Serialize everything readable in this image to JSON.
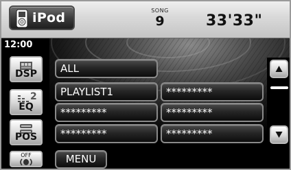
{
  "header": {
    "source_label": "iPod",
    "song_caption": "SONG",
    "song_number": "9",
    "play_time": "33'33\""
  },
  "clock": "12:00",
  "side_buttons": {
    "dsp": {
      "label": "DSP",
      "icon": "dsp-icon"
    },
    "eq": {
      "label": "EQ",
      "badge": "2",
      "icon": "equalizer-icon"
    },
    "pos": {
      "label": "POS",
      "icon": "position-icon"
    },
    "off": {
      "caption": "OFF",
      "icon": "speaker-icon"
    }
  },
  "list": {
    "left": [
      {
        "label": "ALL"
      },
      {
        "label": "PLAYLIST1"
      },
      {
        "label": "*********"
      },
      {
        "label": "*********"
      }
    ],
    "right": [
      {
        "label": "*********"
      },
      {
        "label": "*********"
      },
      {
        "label": "*********"
      }
    ]
  },
  "scrollbar": {
    "up_icon": "triangle-up-icon",
    "down_icon": "triangle-down-icon"
  },
  "footer": {
    "menu_label": "MENU"
  },
  "colors": {
    "background": "#000000",
    "header_bar": "#d9d9d9",
    "button_text": "#ffffff",
    "side_button_text": "#111111"
  }
}
